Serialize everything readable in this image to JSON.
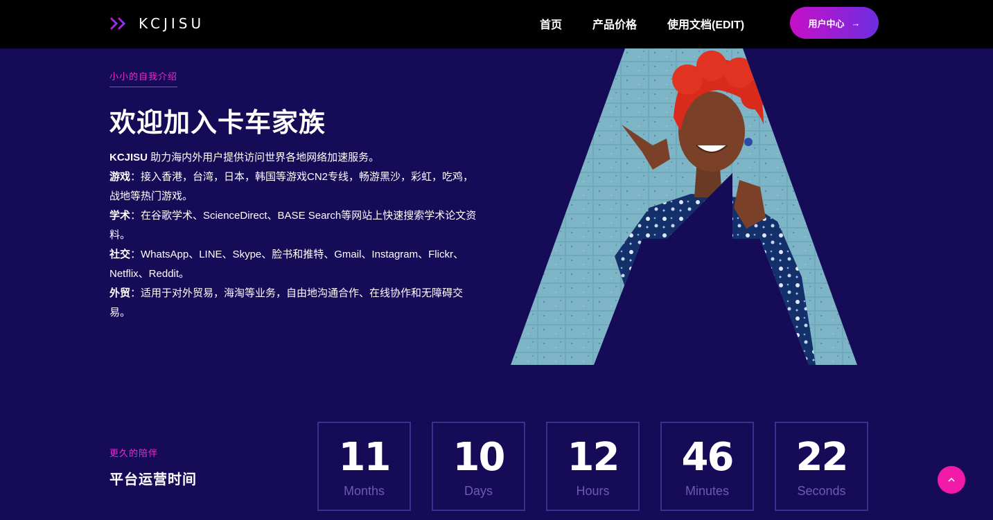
{
  "header": {
    "logo_text": "KCJISU",
    "nav": {
      "home": "首页",
      "pricing": "产品价格",
      "docs": "使用文档(EDIT)"
    },
    "user_center_label": "用户中心",
    "user_center_arrow": "→"
  },
  "intro": {
    "tag": "小小的自我介绍",
    "title": "欢迎加入卡车家族",
    "lead_brand": "KCJISU",
    "lead_text": " 助力海内外用户提供访问世界各地网络加速服务。",
    "items": [
      {
        "label": "游戏",
        "text": "：接入香港，台湾，日本，韩国等游戏CN2专线，畅游黑沙，彩虹，吃鸡，战地等热门游戏。"
      },
      {
        "label": "学术",
        "text": "：在谷歌学术、ScienceDirect、BASE Search等网站上快速搜索学术论文资料。"
      },
      {
        "label": "社交",
        "text": "：WhatsApp、LINE、Skype、脸书和推特、Gmail、Instagram、Flickr、Netflix、Reddit。"
      },
      {
        "label": "外贸",
        "text": "：适用于对外贸易，海淘等业务，自由地沟通合作、在线协作和无障碍交易。"
      }
    ]
  },
  "uptime": {
    "tag": "更久的陪伴",
    "title": "平台运营时间",
    "counters": [
      {
        "value": "11",
        "unit": "Months"
      },
      {
        "value": "10",
        "unit": "Days"
      },
      {
        "value": "12",
        "unit": "Hours"
      },
      {
        "value": "46",
        "unit": "Minutes"
      },
      {
        "value": "22",
        "unit": "Seconds"
      }
    ]
  },
  "colors": {
    "background": "#150b57",
    "header_bg": "#000000",
    "accent_pink": "#ea2bd0",
    "button_gradient_start": "#c70fc8",
    "button_gradient_end": "#6d2de0",
    "counter_border": "#3d2f8e",
    "counter_unit": "#6b5bb5",
    "back_to_top": "#f21aa6"
  },
  "icons": {
    "logo": "double-chevron-icon",
    "back_to_top": "chevron-up-icon"
  }
}
